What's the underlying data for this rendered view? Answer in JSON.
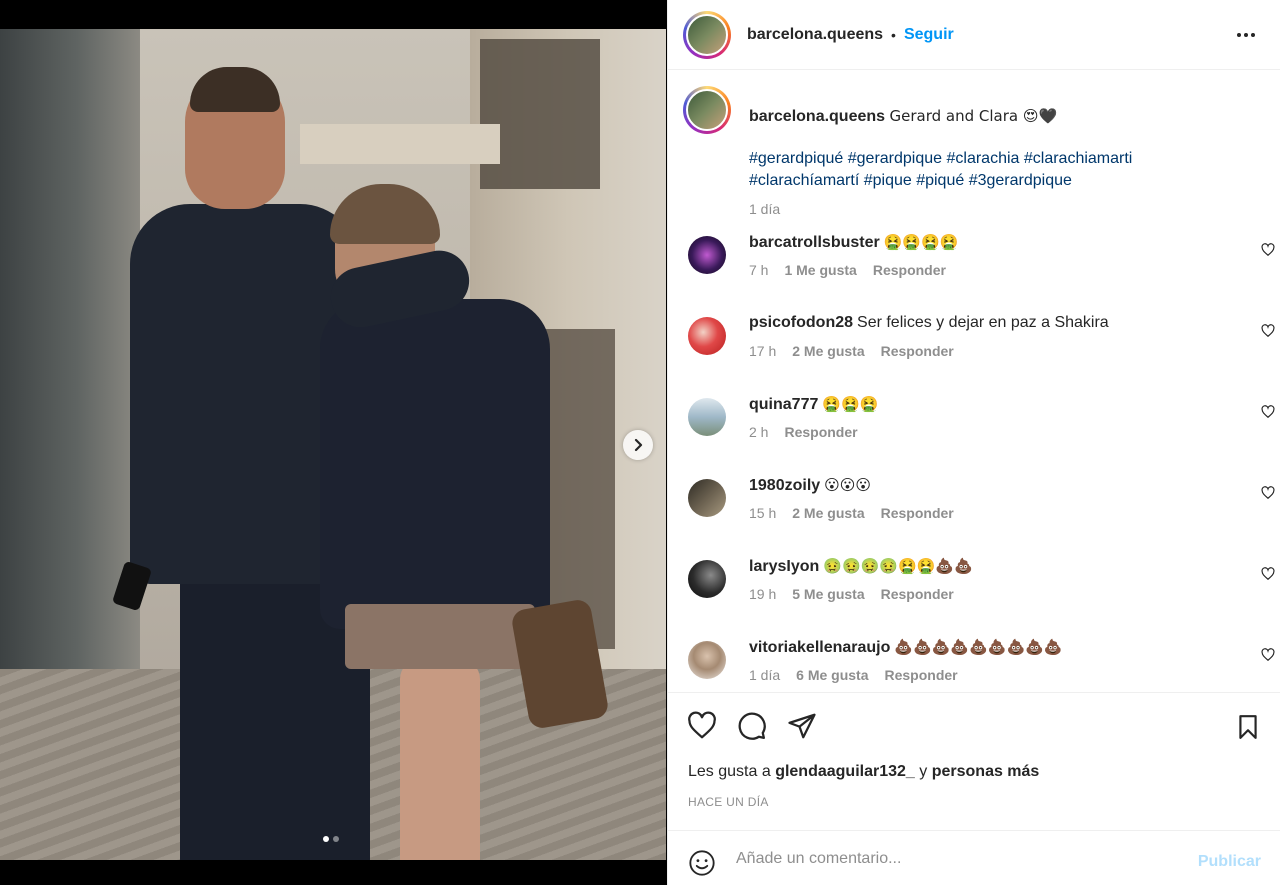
{
  "post": {
    "username": "barcelona.queens",
    "separator": "•",
    "follow_label": "Seguir",
    "caption_text": "Gerard and Clara 😍🖤",
    "hashtags": "#gerardpiqué #gerardpique #clarachia #clarachiamarti #clarachíamartí #pique #piqué #3gerardpique",
    "caption_time": "1 día",
    "image_count": 2,
    "current_image": 1
  },
  "comments": [
    {
      "user": "barcatrollsbuster",
      "text": "🤮🤮🤮🤮",
      "time": "7 h",
      "likes": "1 Me gusta",
      "reply": "Responder",
      "avatar_color": "#2a1440"
    },
    {
      "user": "psicofodon28",
      "text": "Ser felices y dejar en paz a Shakira",
      "time": "17 h",
      "likes": "2 Me gusta",
      "reply": "Responder",
      "avatar_color": "#d63b3b"
    },
    {
      "user": "quina777",
      "text": "🤮🤮🤮",
      "time": "2 h",
      "likes": "",
      "reply": "Responder",
      "avatar_color": "#9fb8c8"
    },
    {
      "user": "1980zoily",
      "text": "😮😮😮",
      "time": "15 h",
      "likes": "2 Me gusta",
      "reply": "Responder",
      "avatar_color": "#5a5143"
    },
    {
      "user": "larysIyon",
      "text": "🤢🤢🤢🤢🤮🤮💩💩",
      "time": "19 h",
      "likes": "5 Me gusta",
      "reply": "Responder",
      "avatar_color": "#1c1c1c"
    },
    {
      "user": "vitoriakellenaraujo",
      "text": "💩💩💩💩💩💩💩💩💩",
      "time": "1 día",
      "likes": "6 Me gusta",
      "reply": "Responder",
      "avatar_color": "#c9b8a8"
    }
  ],
  "actions": {
    "likes_prefix": "Les gusta a",
    "liked_by": "glendaaguilar132_",
    "likes_joiner": "y",
    "likes_suffix": "personas más",
    "posted": "HACE UN DÍA"
  },
  "add_comment": {
    "placeholder": "Añade un comentario...",
    "publish_label": "Publicar"
  },
  "colors": {
    "accent": "#0095f6",
    "hashtag": "#00376b",
    "muted": "#8e8e8e",
    "publish_disabled": "#b2dffc"
  }
}
